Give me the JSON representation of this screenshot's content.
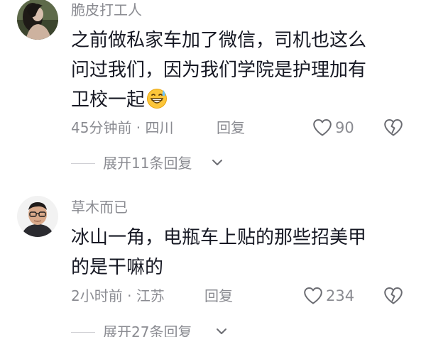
{
  "colors": {
    "primary_text": "#161823",
    "secondary_text": "#8a8b91",
    "divider": "#d0d0d5",
    "icon": "#6b6c72",
    "background": "#ffffff"
  },
  "comments": [
    {
      "username": "脆皮打工人",
      "avatar_icon": "user-photo-avatar",
      "text": "之前做私家车加了微信，司机也这么\n问过我们，因为我们学院是护理加有\n卫校一起",
      "trailing_emoji": "grinning-sweat-emoji",
      "time": "45分钟前",
      "location": "四川",
      "reply_label": "回复",
      "like_count": "90",
      "expand_label": "展开11条回复"
    },
    {
      "username": "草木而已",
      "avatar_icon": "user-photo-avatar",
      "text": "冰山一角，电瓶车上贴的那些招美甲\n的是干嘛的",
      "time": "2小时前",
      "location": "江苏",
      "reply_label": "回复",
      "like_count": "234",
      "expand_label": "展开27条回复"
    }
  ]
}
